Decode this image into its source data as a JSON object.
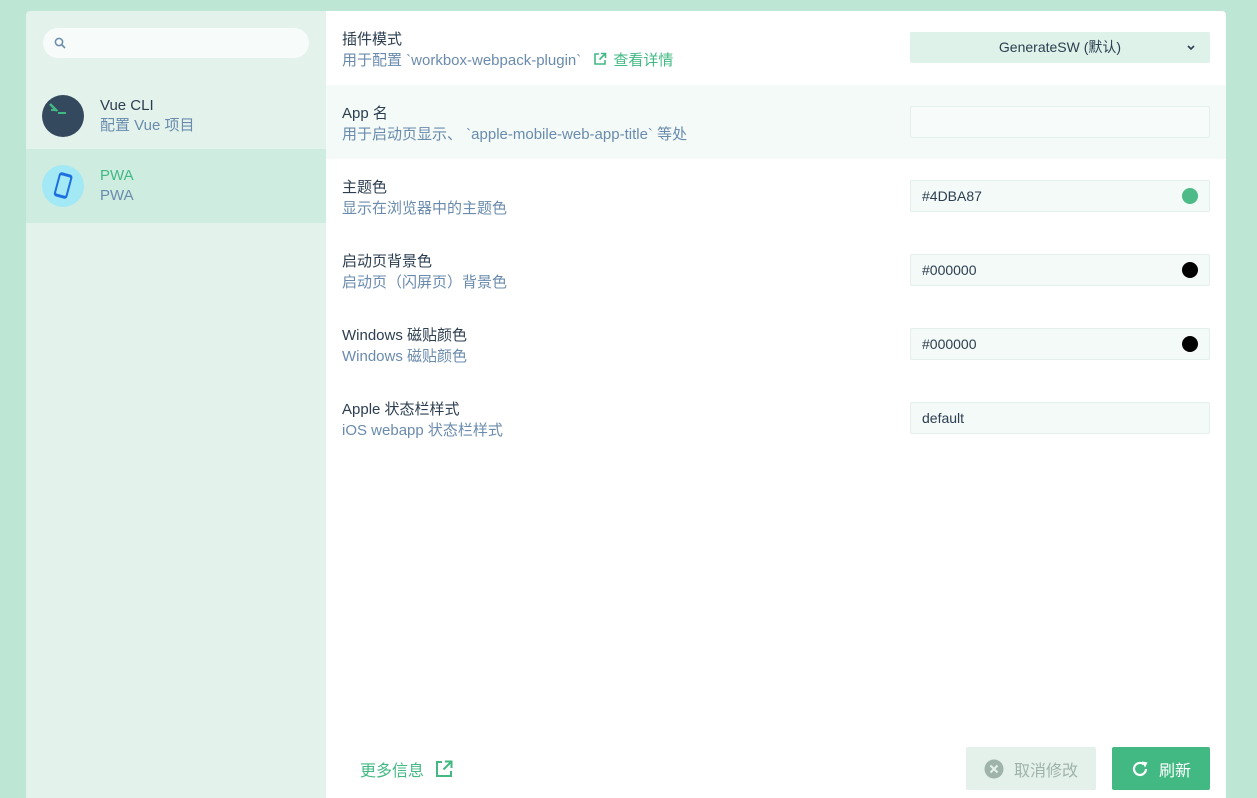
{
  "sidebar": {
    "search": {
      "placeholder": "",
      "value": ""
    },
    "items": [
      {
        "title": "Vue CLI",
        "subtitle": "配置 Vue 项目",
        "icon": "terminal-icon",
        "active": false
      },
      {
        "title": "PWA",
        "subtitle": "PWA",
        "icon": "mobile-phone-icon",
        "active": true
      }
    ]
  },
  "settings": [
    {
      "label": "插件模式",
      "desc_prefix": "用于配置 `workbox-webpack-plugin`",
      "link_text": "查看详情",
      "type": "select",
      "value": "GenerateSW (默认)"
    },
    {
      "label": "App 名",
      "desc": "用于启动页显示、 `apple-mobile-web-app-title` 等处",
      "type": "input",
      "value": ""
    },
    {
      "label": "主题色",
      "desc": "显示在浏览器中的主题色",
      "type": "color",
      "value": "#4DBA87",
      "color": "#4DBA87"
    },
    {
      "label": "启动页背景色",
      "desc": "启动页（闪屏页）背景色",
      "type": "color",
      "value": "#000000",
      "color": "#000000"
    },
    {
      "label": "Windows 磁贴颜色",
      "desc": "Windows 磁贴颜色",
      "type": "color",
      "value": "#000000",
      "color": "#000000"
    },
    {
      "label": "Apple 状态栏样式",
      "desc": "iOS webapp 状态栏样式",
      "type": "input",
      "value": "default"
    }
  ],
  "footer": {
    "more_info": "更多信息",
    "cancel_label": "取消修改",
    "refresh_label": "刷新"
  },
  "colors": {
    "accent": "#42b983",
    "background": "#bde6d4",
    "sidebar": "#e3f3ec",
    "text": "#2c3e50",
    "muted": "#6a8bad"
  }
}
